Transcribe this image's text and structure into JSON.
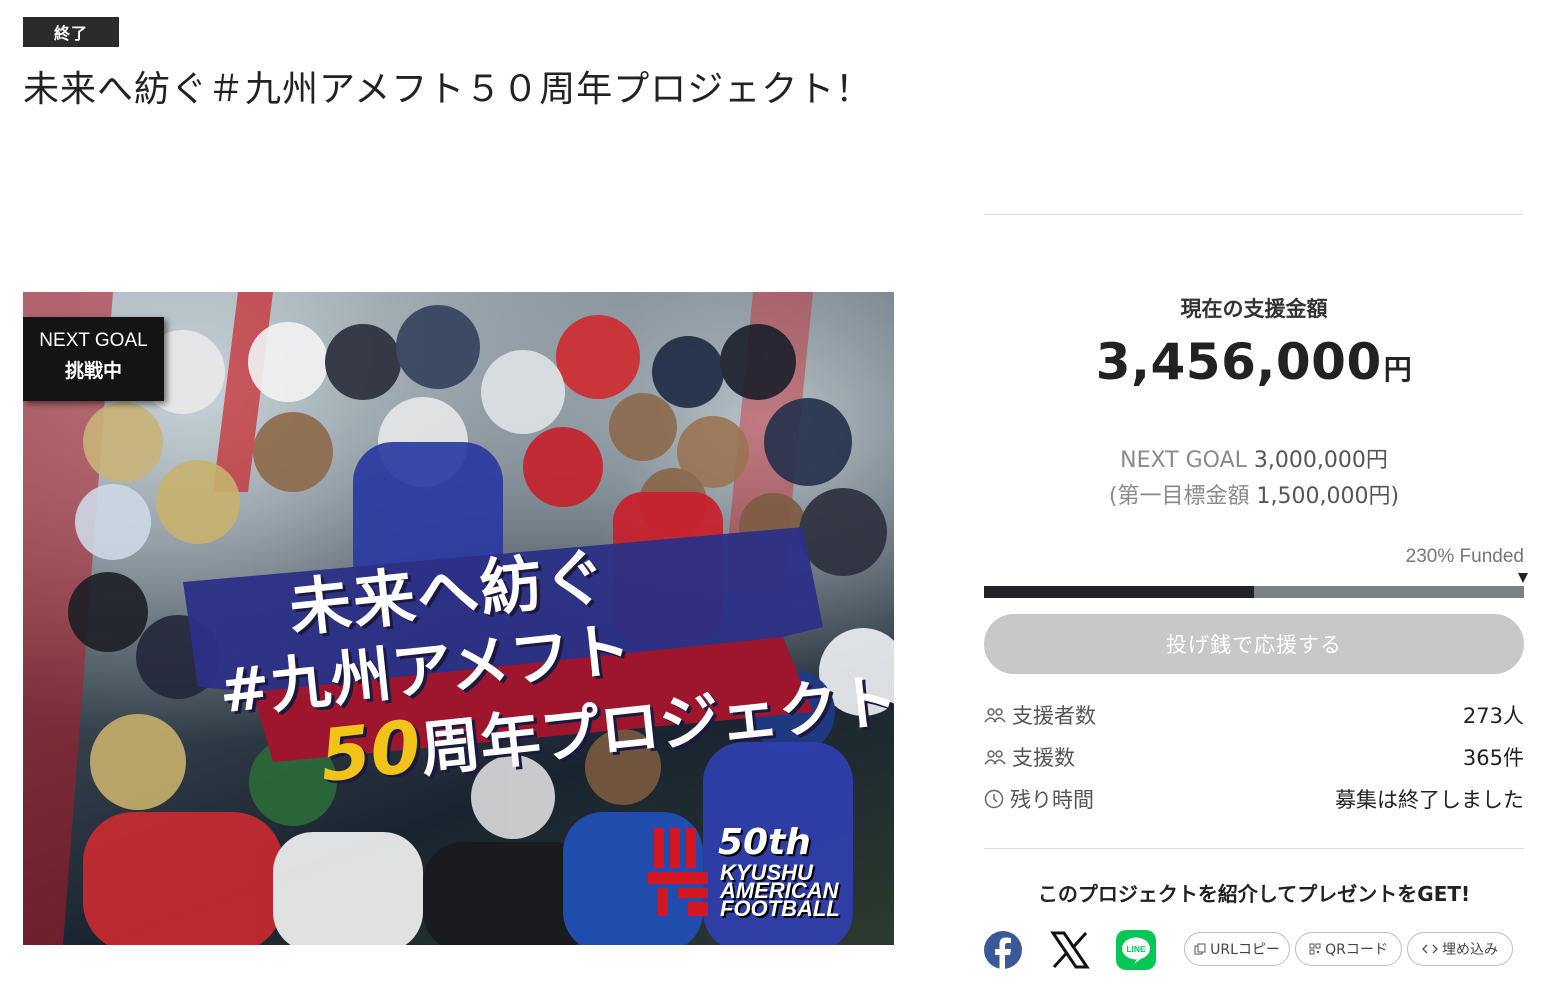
{
  "status_tag": "終了",
  "page_title": "未来へ紡ぐ＃九州アメフト５０周年プロジェクト！",
  "hero": {
    "badge_line1": "NEXT GOAL",
    "badge_line2": "挑戦中",
    "headline_1": "未来へ紡ぐ",
    "headline_2": "#九州アメフト",
    "headline_3_number": "50",
    "headline_3_text": "周年プロジェクト",
    "logo_number": "50th",
    "logo_line1": "KYUSHU",
    "logo_line2": "AMERICAN",
    "logo_line3": "FOOTBALL"
  },
  "funding": {
    "raised_label": "現在の支援金額",
    "raised_amount": "3,456,000",
    "currency": "円",
    "next_goal_label": "NEXT GOAL",
    "next_goal_amount": "3,000,000円",
    "first_goal_prefix": "(第一目標金額",
    "first_goal_amount": "1,500,000円)",
    "funded_text": "230% Funded",
    "progress_fill_fraction": 0.5
  },
  "support_button": "投げ銭で応援する",
  "stats": [
    {
      "label": "支援者数",
      "value": "273人",
      "icon": "people-icon"
    },
    {
      "label": "支援数",
      "value": "365件",
      "icon": "people-icon"
    },
    {
      "label": "残り時間",
      "value": "募集は終了しました",
      "icon": "clock-icon"
    }
  ],
  "share": {
    "title": "このプロジェクトを紹介してプレゼントをGET!",
    "url_copy": "URLコピー",
    "qr_code": "QRコード",
    "embed": "埋め込み"
  },
  "colors": {
    "facebook": "#3b5998",
    "line": "#06c755",
    "progress_fill": "#222326",
    "progress_track": "#7d8185",
    "button_disabled": "#c8c8c8"
  }
}
